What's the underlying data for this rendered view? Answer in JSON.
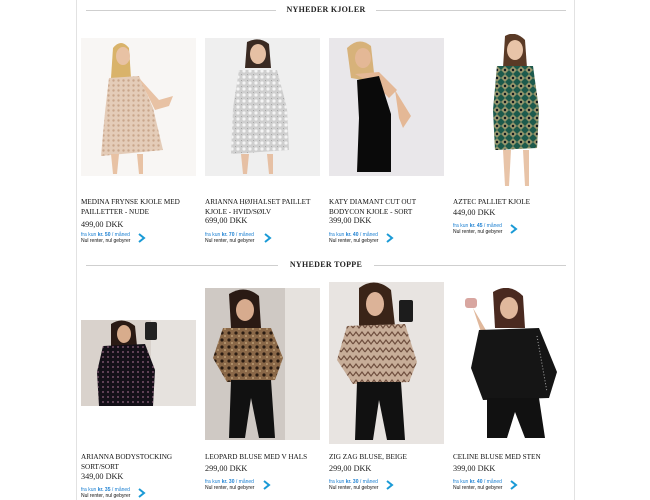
{
  "sections": [
    {
      "title": "NYHEDER KJOLER",
      "products": [
        {
          "name": "MEDINA FRYNSE KJOLE MED PAILLETTER - NUDE",
          "price": "499,00 DKK",
          "finance_prefix": "fra kun",
          "finance_amount": "kr. 50",
          "finance_suffix": "/ måned",
          "finance_note": "Nul renter, nul gebyrer",
          "image_alt": "Model in nude fringe sequin dress"
        },
        {
          "name": "ARIANNA HØJHALSET PAILLET KJOLE - HVID/SØLV",
          "price": "699,00 DKK",
          "finance_prefix": "fra kun",
          "finance_amount": "kr. 70",
          "finance_suffix": "/ måned",
          "finance_note": "Nul renter, nul gebyrer",
          "image_alt": "Model in silver sequin high neck dress"
        },
        {
          "name": "KATY DIAMANT CUT OUT BODYCON KJOLE - SORT",
          "price": "399,00 DKK",
          "finance_prefix": "fra kun",
          "finance_amount": "kr. 40",
          "finance_suffix": "/ måned",
          "finance_note": "Nul renter, nul gebyrer",
          "image_alt": "Model in black bodycon dress"
        },
        {
          "name": "AZTEC PALLIET KJOLE",
          "price": "449,00 DKK",
          "finance_prefix": "fra kun",
          "finance_amount": "kr. 45",
          "finance_suffix": "/ måned",
          "finance_note": "Nul renter, nul gebyrer",
          "image_alt": "Model in aztec sequin dress"
        }
      ]
    },
    {
      "title": "NYHEDER TOPPE",
      "products": [
        {
          "name": "ARIANNA BODYSTOCKING SORT/SORT",
          "price": "349,00 DKK",
          "finance_prefix": "fra kun",
          "finance_amount": "kr. 35",
          "finance_suffix": "/ måned",
          "finance_note": "Nul renter, nul gebyrer",
          "image_alt": "Model in black sequin bodystocking"
        },
        {
          "name": "LEOPARD BLUSE MED V HALS",
          "price": "299,00 DKK",
          "finance_prefix": "fra kun",
          "finance_amount": "kr. 30",
          "finance_suffix": "/ måned",
          "finance_note": "Nul renter, nul gebyrer",
          "image_alt": "Model in leopard blouse"
        },
        {
          "name": "ZIG ZAG BLUSE, BEIGE",
          "price": "299,00 DKK",
          "finance_prefix": "fra kun",
          "finance_amount": "kr. 30",
          "finance_suffix": "/ måned",
          "finance_note": "Nul renter, nul gebyrer",
          "image_alt": "Model in zig zag beige blouse"
        },
        {
          "name": "CELINE BLUSE MED STEN",
          "price": "399,00 DKK",
          "finance_prefix": "fra kun",
          "finance_amount": "kr. 40",
          "finance_suffix": "/ måned",
          "finance_note": "Nul renter, nul gebyrer",
          "image_alt": "Model in black blouse with stones"
        }
      ]
    }
  ],
  "colors": {
    "finance_blue": "#1a7fd1",
    "chevron": "#1a9ad6",
    "text": "#111111"
  }
}
